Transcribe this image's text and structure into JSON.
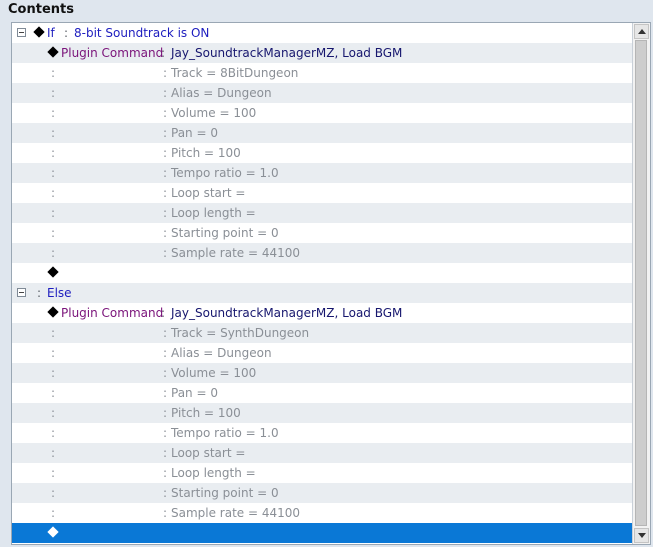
{
  "panel_title": "Contents",
  "rows": [
    {
      "colon": ":",
      "label": "If",
      "text": "8-bit Soundtrack is ON"
    },
    {
      "label": "Plugin Command",
      "colon": ":",
      "text": "Jay_SoundtrackManagerMZ, Load BGM"
    },
    {
      "colon1": ":",
      "colon2": ":",
      "text": "Track = 8BitDungeon"
    },
    {
      "colon1": ":",
      "colon2": ":",
      "text": "Alias = Dungeon"
    },
    {
      "colon1": ":",
      "colon2": ":",
      "text": "Volume = 100"
    },
    {
      "colon1": ":",
      "colon2": ":",
      "text": "Pan = 0"
    },
    {
      "colon1": ":",
      "colon2": ":",
      "text": "Pitch = 100"
    },
    {
      "colon1": ":",
      "colon2": ":",
      "text": "Tempo ratio = 1.0"
    },
    {
      "colon1": ":",
      "colon2": ":",
      "text": "Loop start ="
    },
    {
      "colon1": ":",
      "colon2": ":",
      "text": "Loop length ="
    },
    {
      "colon1": ":",
      "colon2": ":",
      "text": "Starting point = 0"
    },
    {
      "colon1": ":",
      "colon2": ":",
      "text": "Sample rate = 44100"
    },
    {},
    {
      "colon": ":",
      "label": "Else"
    },
    {
      "label": "Plugin Command",
      "colon": ":",
      "text": "Jay_SoundtrackManagerMZ, Load BGM"
    },
    {
      "colon1": ":",
      "colon2": ":",
      "text": "Track = SynthDungeon"
    },
    {
      "colon1": ":",
      "colon2": ":",
      "text": "Alias = Dungeon"
    },
    {
      "colon1": ":",
      "colon2": ":",
      "text": "Volume = 100"
    },
    {
      "colon1": ":",
      "colon2": ":",
      "text": "Pan = 0"
    },
    {
      "colon1": ":",
      "colon2": ":",
      "text": "Pitch = 100"
    },
    {
      "colon1": ":",
      "colon2": ":",
      "text": "Tempo ratio = 1.0"
    },
    {
      "colon1": ":",
      "colon2": ":",
      "text": "Loop start ="
    },
    {
      "colon1": ":",
      "colon2": ":",
      "text": "Loop length ="
    },
    {
      "colon1": ":",
      "colon2": ":",
      "text": "Starting point = 0"
    },
    {
      "colon1": ":",
      "colon2": ":",
      "text": "Sample rate = 44100"
    },
    {}
  ],
  "colors": {
    "condition_text": "#1d1dbf",
    "plugin_label": "#7a137a",
    "plugin_text": "#16166e",
    "param_text": "#8a8f96",
    "selection": "#0a78d6"
  },
  "icons": {
    "toggle": "collapse-box-icon",
    "command_marker": "diamond-icon",
    "scroll_up": "arrow-up-icon",
    "scroll_down": "arrow-down-icon"
  }
}
